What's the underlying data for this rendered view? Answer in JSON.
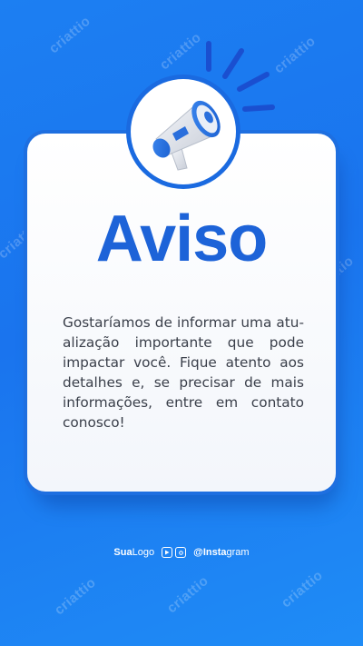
{
  "watermark": {
    "text": "criattio"
  },
  "title": "Aviso",
  "message": "Gostaríamos de informar uma atu­alização importante que pode impactar você. Fique atento aos detalhes e, se precisar de mais informações, entre em contato conosco!",
  "footer": {
    "logo_bold": "Sua",
    "logo_regular": "Logo",
    "handle_bold": "@Insta",
    "handle_regular": "gram",
    "icons": [
      "youtube-icon",
      "instagram-icon"
    ]
  },
  "colors": {
    "background": "#1c7ff2",
    "accent": "#1d63d8",
    "card": "#ffffff",
    "text": "#3a3f4a"
  }
}
